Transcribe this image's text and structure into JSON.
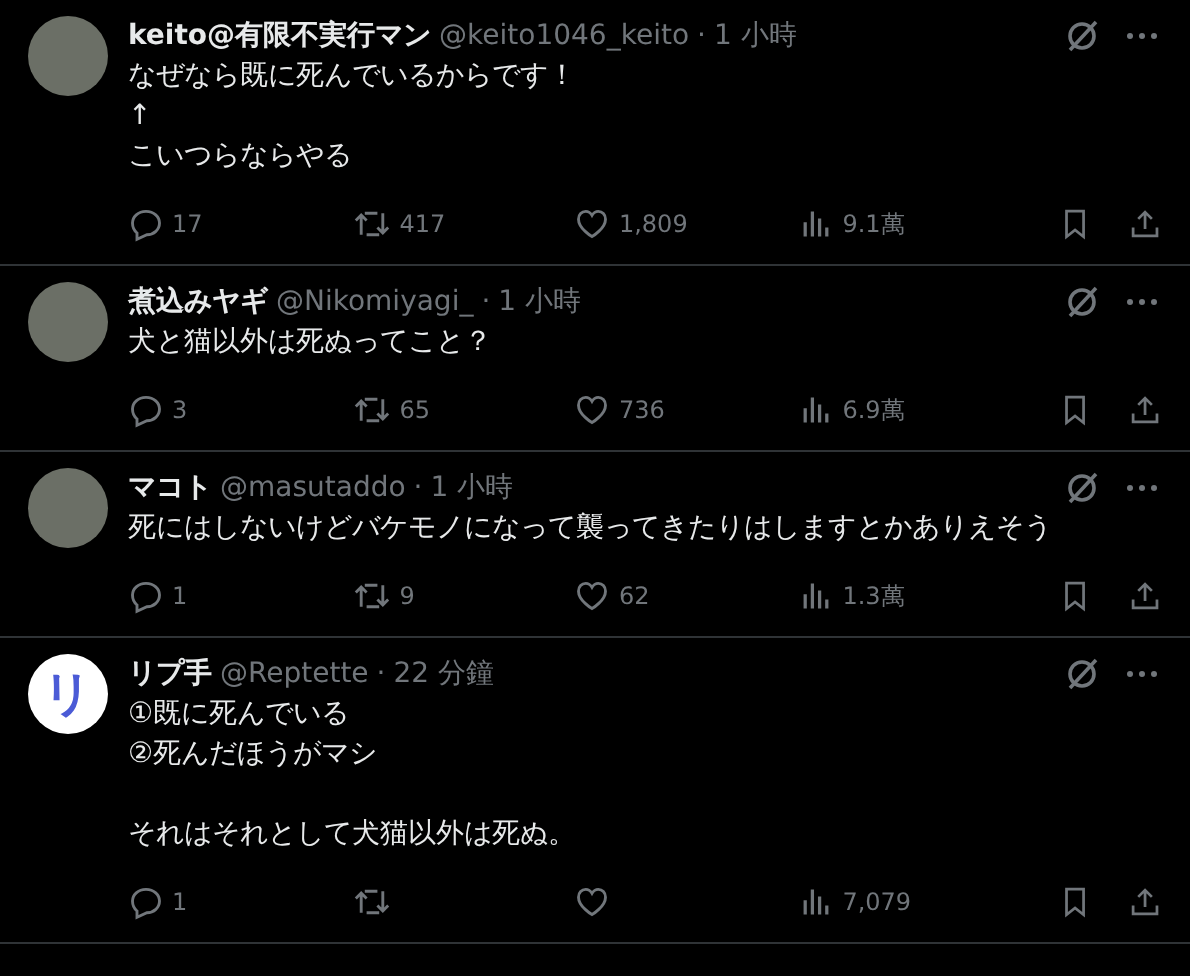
{
  "posts": [
    {
      "avatar": {
        "kind": "photo"
      },
      "name": "keito@有限不実行マン",
      "handle": "@keito1046_keito",
      "separator": "·",
      "time": "1 小時",
      "paragraphs": [
        [
          "なぜなら既に死んでいるからです！",
          "↑",
          "こいつらならやる"
        ]
      ],
      "stats": {
        "replies": "17",
        "reposts": "417",
        "likes": "1,809",
        "views": "9.1萬"
      }
    },
    {
      "avatar": {
        "kind": "photo"
      },
      "name": "煮込みヤギ",
      "handle": "@Nikomiyagi_",
      "separator": "·",
      "time": "1 小時",
      "paragraphs": [
        [
          "犬と猫以外は死ぬってこと？"
        ]
      ],
      "stats": {
        "replies": "3",
        "reposts": "65",
        "likes": "736",
        "views": "6.9萬"
      }
    },
    {
      "avatar": {
        "kind": "photo"
      },
      "name": "マコト",
      "handle": "@masutaddo",
      "separator": "·",
      "time": "1 小時",
      "paragraphs": [
        [
          "死にはしないけどバケモノになって襲ってきたりはしますとかありえそう"
        ]
      ],
      "stats": {
        "replies": "1",
        "reposts": "9",
        "likes": "62",
        "views": "1.3萬"
      }
    },
    {
      "avatar": {
        "kind": "letter",
        "text": "リ"
      },
      "name": "リプ手",
      "handle": "@Reptette",
      "separator": "·",
      "time": "22 分鐘",
      "paragraphs": [
        [
          "①既に死んでいる",
          "②死んだほうがマシ"
        ],
        [
          "それはそれとして犬猫以外は死ぬ。"
        ]
      ],
      "stats": {
        "replies": "1",
        "views": "7,079"
      }
    }
  ]
}
